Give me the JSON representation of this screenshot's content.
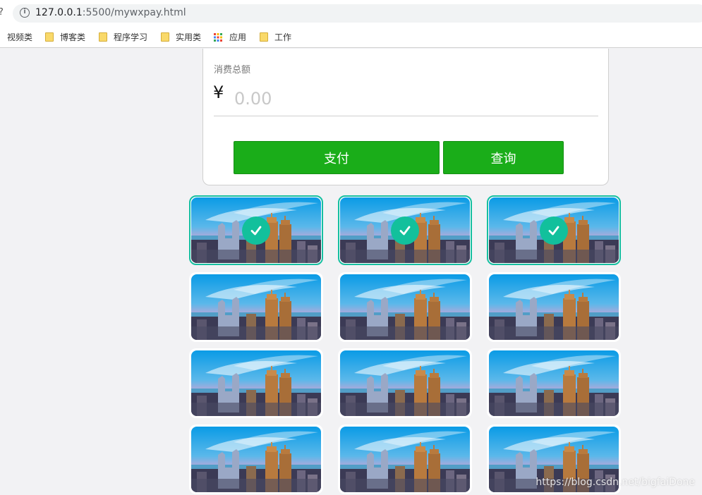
{
  "browser": {
    "url_host": "127.0.0.1",
    "url_rest": ":5500/mywxpay.html",
    "bookmarks": [
      {
        "label": "视频类",
        "icon": "none"
      },
      {
        "label": "博客类",
        "icon": "folder-icon"
      },
      {
        "label": "程序学习",
        "icon": "folder-icon"
      },
      {
        "label": "实用类",
        "icon": "folder-icon"
      },
      {
        "label": "应用",
        "icon": "apps-icon"
      },
      {
        "label": "工作",
        "icon": "folder-icon"
      }
    ]
  },
  "payment": {
    "label": "消费总额",
    "currency": "¥",
    "amount_placeholder": "0.00",
    "pay_label": "支付",
    "query_label": "查询",
    "accent": "#1aad19"
  },
  "gallery": {
    "selected_color": "#15bfa0",
    "tiles": [
      {
        "selected": true
      },
      {
        "selected": true
      },
      {
        "selected": true
      },
      {
        "selected": false
      },
      {
        "selected": false
      },
      {
        "selected": false
      },
      {
        "selected": false
      },
      {
        "selected": false
      },
      {
        "selected": false
      },
      {
        "selected": false
      },
      {
        "selected": false
      },
      {
        "selected": false
      }
    ]
  },
  "watermark": "https://blog.csdn.net/bigfaiDone"
}
